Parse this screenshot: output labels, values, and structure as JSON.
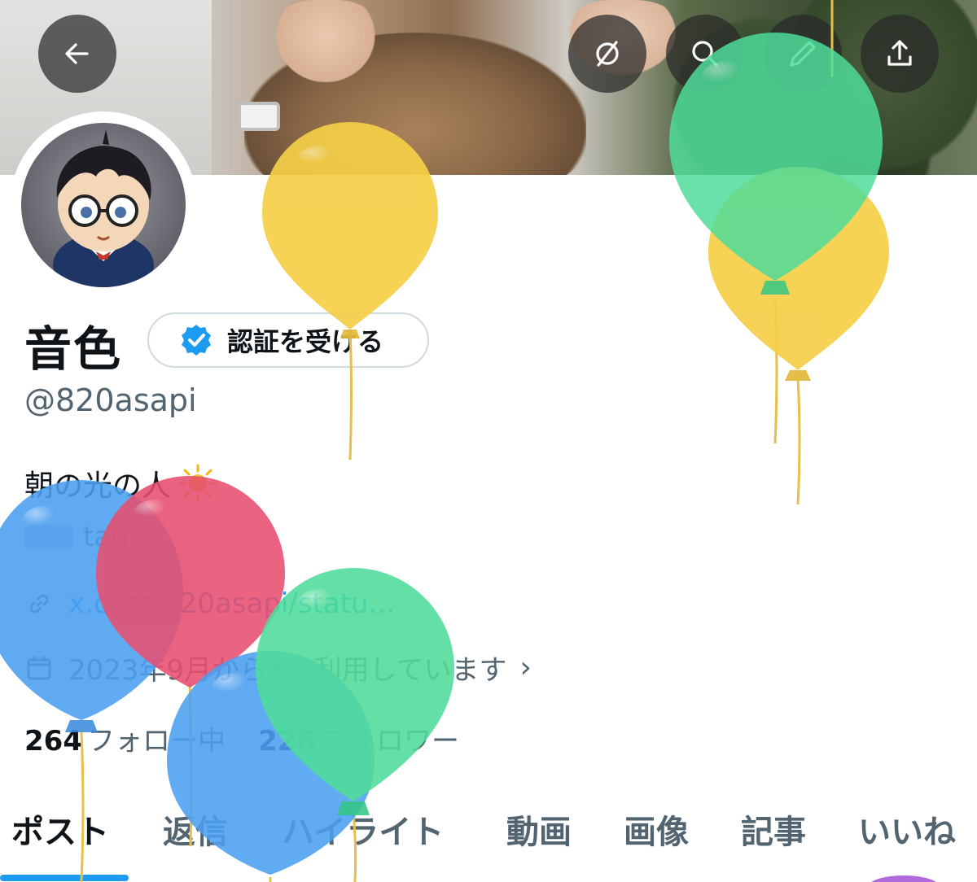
{
  "profile": {
    "display_name": "音色",
    "handle": "@820asapi",
    "verify_button_label": "認証を受ける",
    "bio": "朝の光の人",
    "tag_text": "tag",
    "link_text": "x.com/820asapi/statu...",
    "join_text": "2023年9月からXを利用しています",
    "following_count": "264",
    "following_label": "フォロー中",
    "followers_count": "226",
    "followers_label": "フォロワー"
  },
  "tabs": [
    {
      "label": "ポスト",
      "active": true
    },
    {
      "label": "返信",
      "active": false
    },
    {
      "label": "ハイライト",
      "active": false
    },
    {
      "label": "動画",
      "active": false
    },
    {
      "label": "画像",
      "active": false
    },
    {
      "label": "記事",
      "active": false
    },
    {
      "label": "いいね",
      "active": false
    }
  ],
  "header_icons": [
    "back-arrow-icon",
    "grok-icon",
    "search-icon",
    "edit-icon",
    "share-icon"
  ],
  "colors": {
    "accent": "#1d9bf0",
    "text_primary": "#0f1419",
    "text_secondary": "#536471",
    "balloon_yellow": "#f5cf47",
    "balloon_green": "#4fdc9a",
    "balloon_blue": "#4b9ff0",
    "balloon_red": "#e74e6f"
  }
}
